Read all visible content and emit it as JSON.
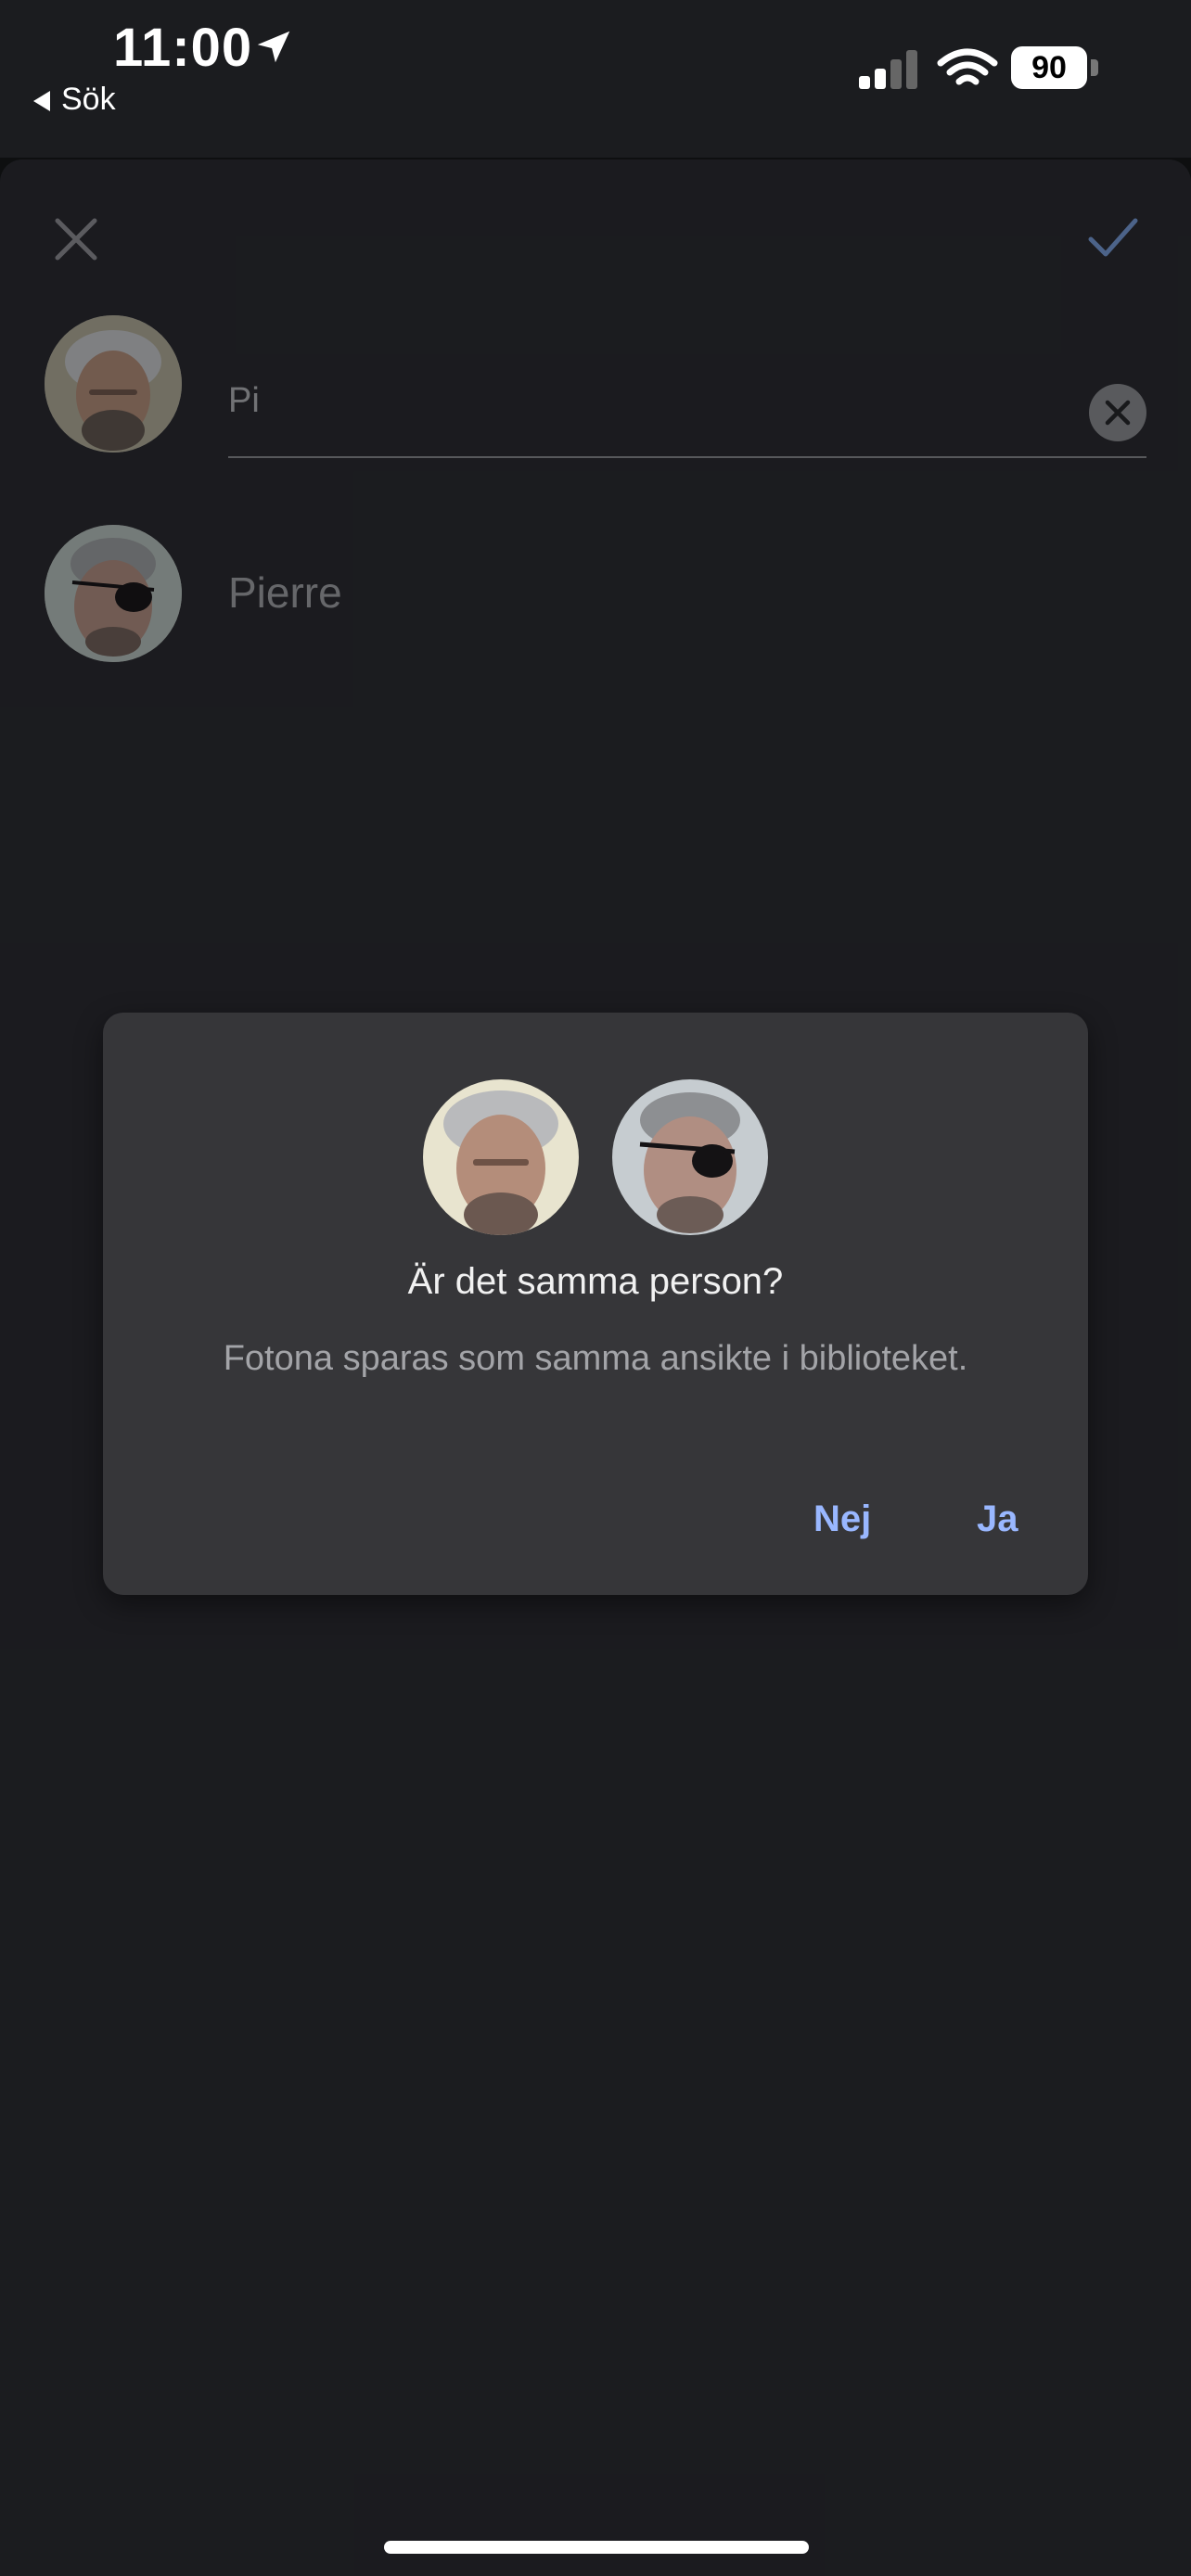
{
  "status_bar": {
    "time": "11:00",
    "back_label": "Sök",
    "battery_level": "90",
    "icons": [
      "location-arrow-icon",
      "signal-icon",
      "wifi-icon",
      "battery-icon"
    ]
  },
  "sheet": {
    "close_icon": "close-icon",
    "confirm_icon": "check-icon",
    "name_input": {
      "value": "Pi",
      "placeholder": ""
    },
    "suggestion": {
      "name": "Pierre"
    }
  },
  "dialog": {
    "title": "Är det samma person?",
    "body": "Fotona sparas som samma ansikte i biblioteket.",
    "no_label": "Nej",
    "yes_label": "Ja"
  },
  "colors": {
    "sheet_bg": "#212226",
    "dialog_bg": "#363639",
    "accent": "#99b7ff"
  }
}
